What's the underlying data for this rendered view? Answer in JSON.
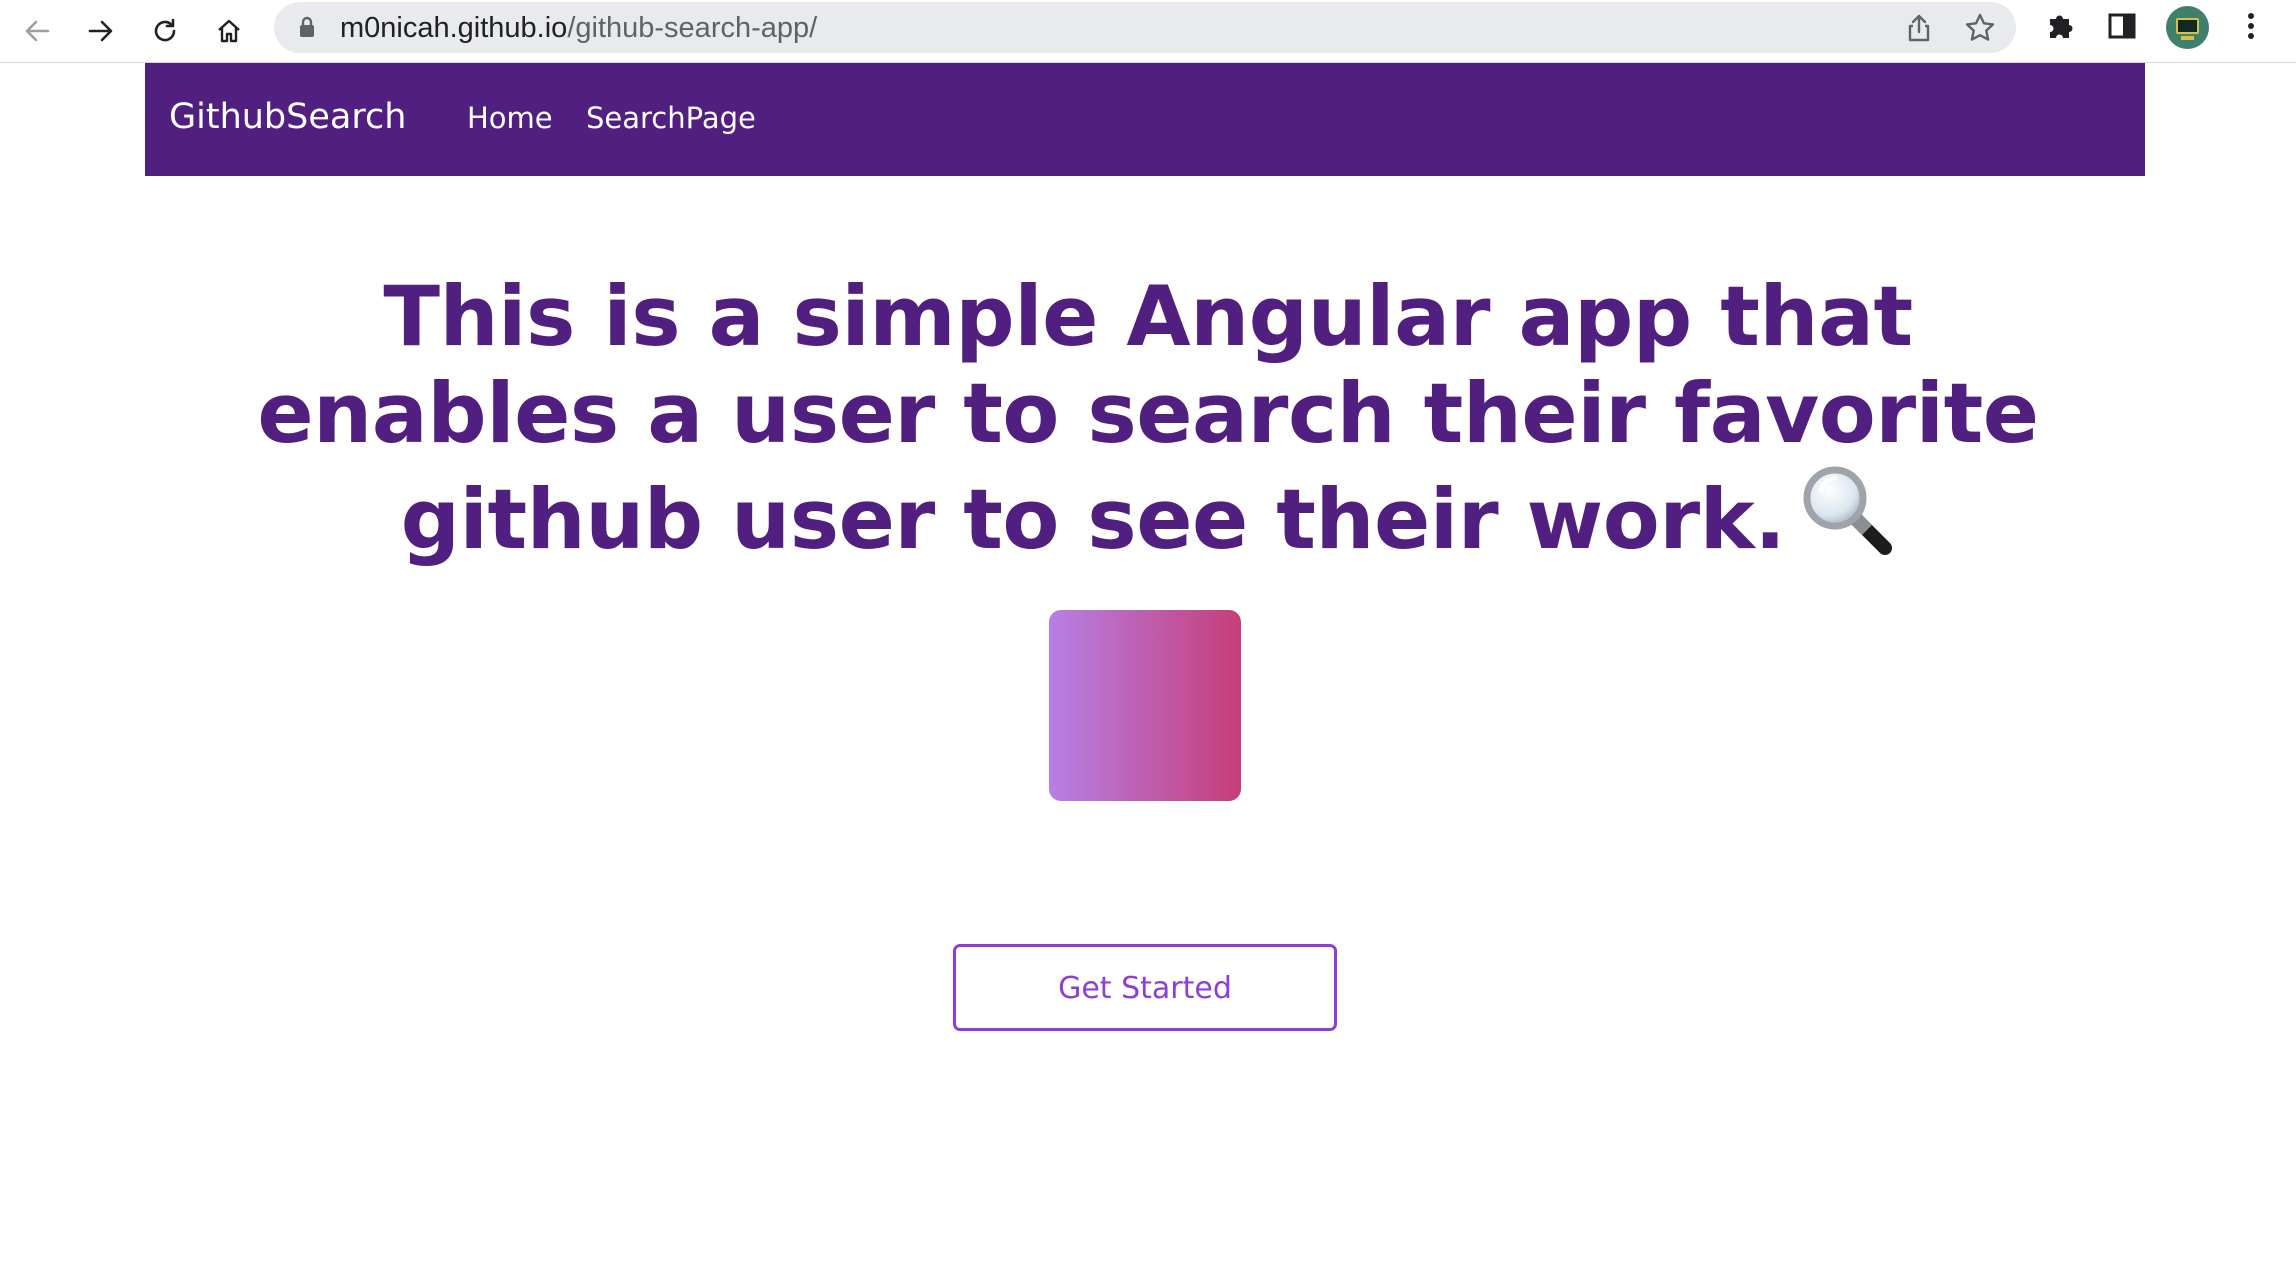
{
  "browser": {
    "url_host": "m0nicah.github.io",
    "url_path": "/github-search-app/",
    "icons": {
      "back": "back-arrow-icon",
      "forward": "forward-arrow-icon",
      "reload": "reload-icon",
      "home": "home-icon",
      "lock": "lock-icon",
      "share": "share-icon",
      "bookmark": "star-icon",
      "extensions": "puzzle-icon",
      "side_panel": "side-panel-icon",
      "profile": "avatar",
      "menu": "kebab-menu-icon"
    }
  },
  "navbar": {
    "brand": "GithubSearch",
    "links": [
      {
        "label": "Home"
      },
      {
        "label": "SearchPage"
      }
    ],
    "background": "#511f80"
  },
  "hero": {
    "title": "This is a simple Angular app that enables a user to search their favorite github user to see their work.",
    "title_icon": "magnifier-icon",
    "title_color": "#511f80",
    "gradient_colors": [
      "#b77fe6",
      "#c63e78"
    ],
    "cta_label": "Get Started",
    "cta_color": "#8e3ed6"
  }
}
